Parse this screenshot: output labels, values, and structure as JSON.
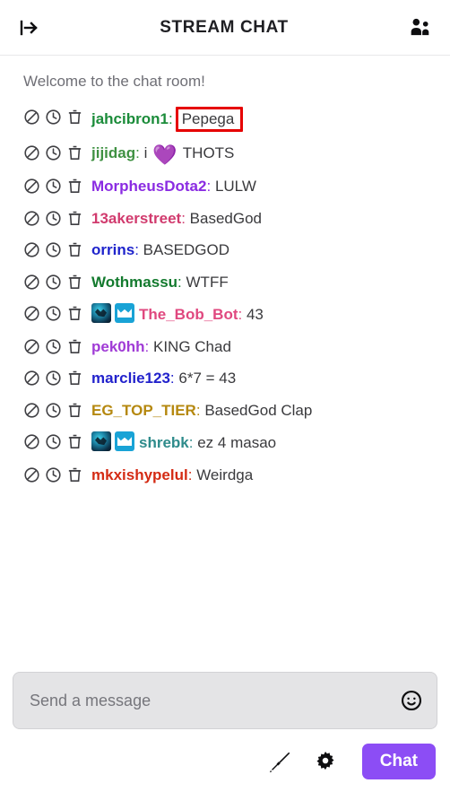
{
  "header": {
    "title": "STREAM CHAT",
    "collapse_icon": "collapse-right-arrow-icon",
    "viewers_icon": "viewer-list-icon"
  },
  "system_message": "Welcome to the chat room!",
  "mod_actions": {
    "ban_icon": "ban-icon",
    "timeout_icon": "timeout-clock-icon",
    "delete_icon": "delete-trash-icon"
  },
  "messages": [
    {
      "username": "jahcibron1",
      "color": "#1b8c3a",
      "separator": ":",
      "text": "Pepega",
      "badges": [],
      "highlighted": true
    },
    {
      "username": "jijidag",
      "color": "#3f9142",
      "separator": ":",
      "text_before": "i",
      "emote": "purple-heart",
      "emote_glyph": "💜",
      "text_after": "THOTS",
      "badges": [],
      "highlighted": false
    },
    {
      "username": "MorpheusDota2",
      "color": "#8a2be2",
      "separator": ":",
      "text": "LULW",
      "badges": [],
      "highlighted": false
    },
    {
      "username": "13akerstreet",
      "color": "#d13b6e",
      "separator": ":",
      "text": "BasedGod",
      "badges": [],
      "highlighted": false
    },
    {
      "username": "orrins",
      "color": "#1f24cc",
      "separator": ":",
      "text": "BASEDGOD",
      "badges": [],
      "highlighted": false
    },
    {
      "username": "Wothmassu",
      "color": "#137a2e",
      "separator": ":",
      "text": "WTFF",
      "badges": [],
      "highlighted": false
    },
    {
      "username": "The_Bob_Bot",
      "color": "#e0487f",
      "separator": ":",
      "text": "43",
      "badges": [
        "subscriber-badge",
        "crown-badge"
      ],
      "highlighted": false
    },
    {
      "username": "pek0hh",
      "color": "#a03bd6",
      "separator": ":",
      "text": "KING Chad",
      "badges": [],
      "highlighted": false
    },
    {
      "username": "marclie123",
      "color": "#2222cc",
      "separator": ":",
      "text": "6*7 = 43",
      "badges": [],
      "highlighted": false
    },
    {
      "username": "EG_TOP_TIER",
      "color": "#b5880f",
      "separator": ":",
      "text": "BasedGod Clap",
      "badges": [],
      "highlighted": false
    },
    {
      "username": "shrebk",
      "color": "#2e8b8b",
      "separator": ":",
      "text": "ez 4 masao",
      "badges": [
        "subscriber-badge",
        "crown-badge"
      ],
      "highlighted": false
    },
    {
      "username": "mkxishypelul",
      "color": "#d42b14",
      "separator": ":",
      "text": "Weirdga",
      "badges": [],
      "highlighted": false
    }
  ],
  "composer": {
    "placeholder": "Send a message",
    "value": "",
    "emote_icon": "smiley-emote-icon"
  },
  "footer": {
    "mod_tools_icon": "sword-mod-tools-icon",
    "settings_icon": "gear-settings-icon",
    "send_label": "Chat",
    "send_color": "#8c4df5"
  },
  "annotation": {
    "highlight_color": "#e60000"
  }
}
